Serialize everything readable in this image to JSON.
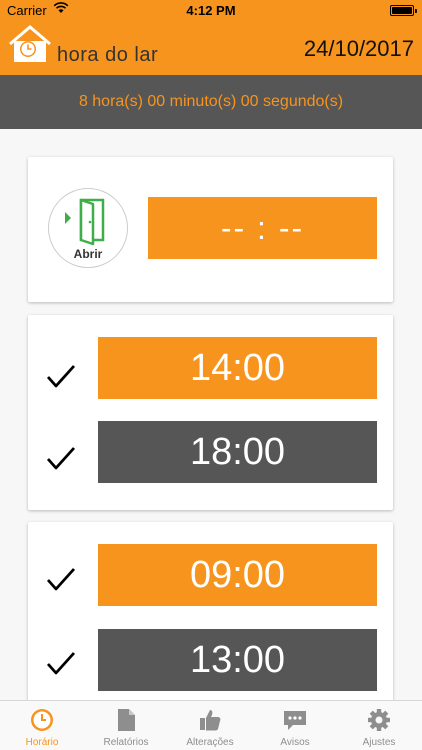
{
  "status_bar": {
    "carrier": "Carrier",
    "time": "4:12 PM"
  },
  "header": {
    "logo_text": "hora do lar",
    "date": "24/10/2017"
  },
  "countdown": {
    "text": "8 hora(s) 00 minuto(s) 00 segundo(s)"
  },
  "door": {
    "label": "Abrir",
    "time_placeholder": "-- : --"
  },
  "schedule_groups": [
    {
      "entries": [
        {
          "time": "14:00",
          "checked": true
        },
        {
          "time": "18:00",
          "checked": true
        }
      ]
    },
    {
      "entries": [
        {
          "time": "09:00",
          "checked": true
        },
        {
          "time": "13:00",
          "checked": true
        }
      ]
    }
  ],
  "tabs": [
    {
      "label": "Horário",
      "icon": "clock-icon",
      "active": true
    },
    {
      "label": "Relatórios",
      "icon": "document-icon",
      "active": false
    },
    {
      "label": "Alterações",
      "icon": "thumbs-up-icon",
      "active": false
    },
    {
      "label": "Avisos",
      "icon": "chat-bubble-icon",
      "active": false
    },
    {
      "label": "Ajustes",
      "icon": "gear-icon",
      "active": false
    }
  ],
  "colors": {
    "accent": "#f7941d",
    "dark": "#565656",
    "inactive": "#8e8e8e"
  }
}
